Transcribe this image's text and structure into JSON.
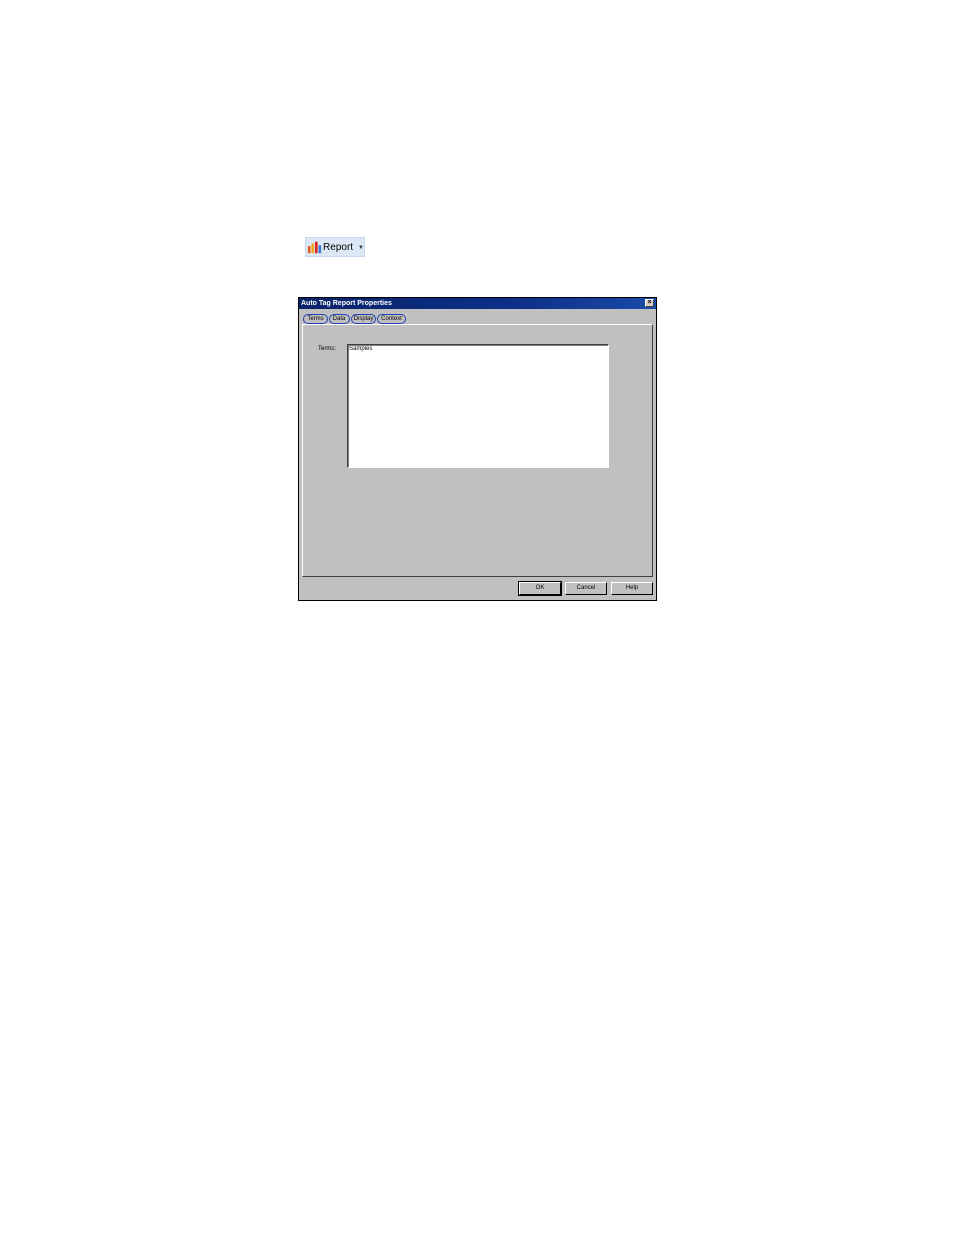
{
  "toolbar": {
    "report_label": "Report",
    "report_icon": "bar-chart-icon",
    "dropdown_icon": "chevron-down-icon"
  },
  "dialog": {
    "title": "Auto Tag Report Properties",
    "close_glyph": "×",
    "tabs": [
      {
        "label": "Terms",
        "selected": true
      },
      {
        "label": "Data",
        "selected": false
      },
      {
        "label": "Display",
        "selected": false
      },
      {
        "label": "Context",
        "selected": false
      }
    ],
    "terms_label": "Terms:",
    "terms_value": "Samples",
    "buttons": {
      "ok": "OK",
      "cancel": "Cancel",
      "help": "Help"
    }
  },
  "colors": {
    "title_bar": "#0a246a",
    "dialog_bg": "#c0c0c0",
    "tab_highlight": "#1f3fb5",
    "report_button_bg": "#dde8f6"
  }
}
